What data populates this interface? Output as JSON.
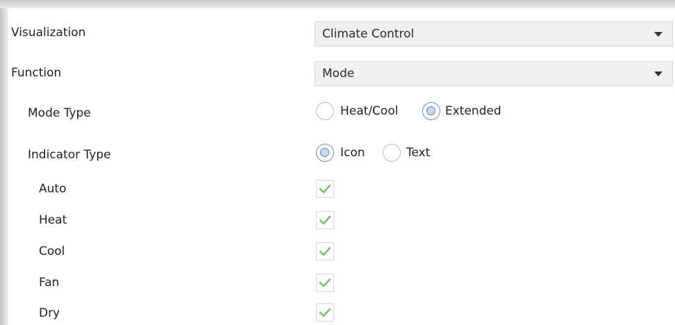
{
  "rows": {
    "visualization": {
      "label": "Visualization",
      "value": "Climate Control"
    },
    "function": {
      "label": "Function",
      "value": "Mode"
    },
    "mode_type": {
      "label": "Mode Type",
      "options": [
        {
          "label": "Heat/Cool",
          "checked": false
        },
        {
          "label": "Extended",
          "checked": true
        }
      ]
    },
    "indicator_type": {
      "label": "Indicator Type",
      "options": [
        {
          "label": "Icon",
          "checked": true
        },
        {
          "label": "Text",
          "checked": false
        }
      ]
    }
  },
  "checkbox_rows": [
    {
      "label": "Auto",
      "checked": true
    },
    {
      "label": "Heat",
      "checked": true
    },
    {
      "label": "Cool",
      "checked": true
    },
    {
      "label": "Fan",
      "checked": true
    },
    {
      "label": "Dry",
      "checked": true
    }
  ],
  "colors": {
    "check": "#7cbf68",
    "radio_accent": "#5f7fa6",
    "select_bg": "#f0f0f0"
  }
}
